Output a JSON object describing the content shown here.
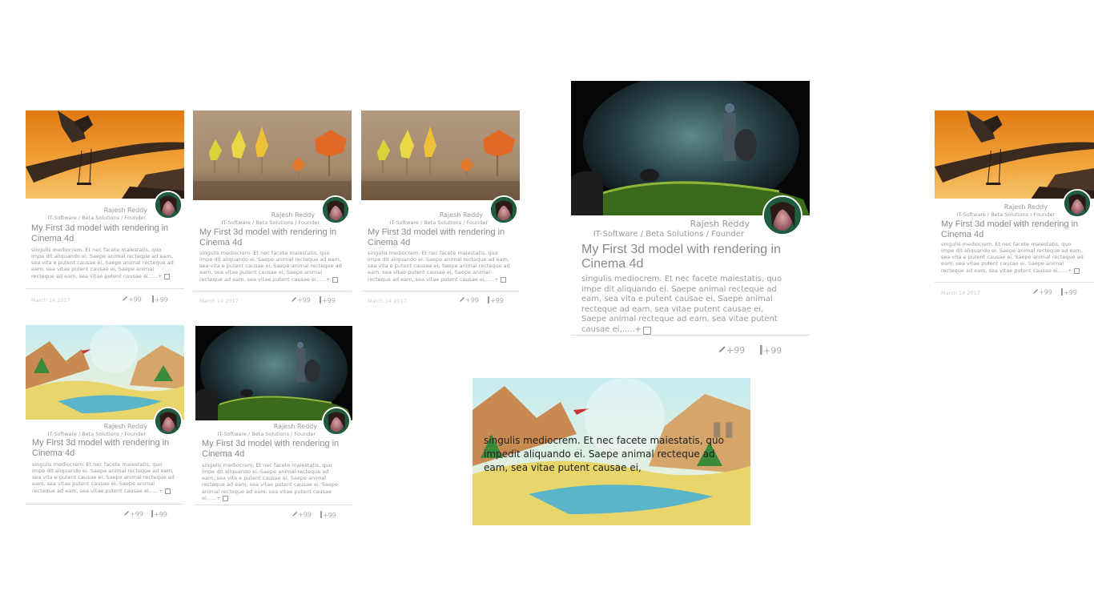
{
  "cards": [
    {
      "author": "Rajesh Reddy",
      "role": "IT-Software / Beta Solutions / Founder",
      "title": "My First 3d model with rendering in Cinema 4d",
      "excerpt": "singulis mediocrem. Et nec facete maiestatis, quo impe dit aliquando ei. Saepe animal recteque ad eam, sea vita e putent causae ei, Saepe animal recteque ad eam, sea vitae putent causae ei, Saepe animal recteque ad eam, sea vitae putent causae ei,.....+",
      "date": "March 14 2017",
      "edits": "+99",
      "comments": "+99",
      "image": "tree-swing"
    },
    {
      "author": "Rajesh Reddy",
      "role": "IT-Software / Beta Solutions / Founder",
      "title": "My First 3d model with rendering in Cinema 4d",
      "excerpt": "singulis mediocrem. Et nec facete maiestatis, quo impe dit aliquando ei. Saepe animal recteque ad eam, sea vita e putent causae ei, Saepe animal recteque ad eam, sea vitae putent causae ei, Saepe animal recteque ad eam, sea vitae putent causae ei,.....+",
      "date": "March 14 2017",
      "edits": "+99",
      "comments": "+99",
      "image": "lowpoly-trees"
    },
    {
      "author": "Rajesh Reddy",
      "role": "IT-Software / Beta Solutions / Founder",
      "title": "My First 3d model with rendering in Cinema 4d",
      "excerpt": "singulis mediocrem. Et nec facete maiestatis, quo impe dit aliquando ei. Saepe animal recteque ad eam, sea vita e putent causae ei, Saepe animal recteque ad eam, sea vitae putent causae ei, Saepe animal recteque ad eam, sea vitae putent causae ei,.....+",
      "date": "March 14 2017",
      "edits": "+99",
      "comments": "+99",
      "image": "lowpoly-trees"
    },
    {
      "author": "Rajesh Reddy",
      "role": "IT-Software / Beta Solutions / Founder",
      "title": "My First 3d model with rendering in Cinema 4d",
      "excerpt": "singulis mediocrem. Et nec facete maiestatis, quo impe dit aliquando ei. Saepe animal recteque ad eam, sea vita e putent causae ei, Saepe animal recteque ad eam, sea vitae putent causae ei, Saepe animal recteque ad eam, sea vitae putent causae ei,.....+",
      "date": "",
      "edits": "+99",
      "comments": "+99",
      "image": "warrior-scene"
    },
    {
      "author": "Rajesh Reddy",
      "role": "IT-Software / Beta Solutions / Founder",
      "title": "My First 3d model with rendering in Cinema 4d",
      "excerpt": "singulis mediocrem. Et nec facete maiestatis, quo impe dit aliquando ei. Saepe animal recteque ad eam, sea vita e putent causae ei, Saepe animal recteque ad eam, sea vitae putent causae ei, Saepe animal recteque ad eam, sea vitae putent causae ei,.....+",
      "date": "March 14 2017",
      "edits": "+99",
      "comments": "+99",
      "image": "tree-swing"
    },
    {
      "author": "Rajesh Reddy",
      "role": "IT-Software / Beta Solutions / Founder",
      "title": "My First 3d model with rendering in Cinema 4d",
      "excerpt": "singulis mediocrem. Et nec facete maiestatis, quo impe dit aliquando ei. Saepe animal recteque ad eam, sea vita e putent causae ei, Saepe animal recteque ad eam, sea vitae putent causae ei, Saepe animal recteque ad eam, sea vitae putent causae ei,.....+",
      "date": "",
      "edits": "+99",
      "comments": "+99",
      "image": "lowpoly-landscape"
    },
    {
      "author": "Rajesh Reddy",
      "role": "IT-Software / Beta Solutions / Founder",
      "title": "My First 3d model with rendering in Cinema 4d",
      "excerpt": "singulis mediocrem. Et nec facete maiestatis, quo impe dit aliquando ei. Saepe animal recteque ad eam, sea vita e putent causae ei, Saepe animal recteque ad eam, sea vitae putent causae ei, Saepe animal recteque ad eam, sea vitae putent causae ei,.....+",
      "date": "",
      "edits": "+99",
      "comments": "+99",
      "image": "warrior-scene"
    }
  ],
  "quote": {
    "mark": "\"",
    "text": "singulis mediocrem. Et nec facete maiestatis, quo impedit aliquando ei. Saepe animal recteque ad eam, sea vitae putent causae ei,",
    "image": "lowpoly-landscape"
  }
}
